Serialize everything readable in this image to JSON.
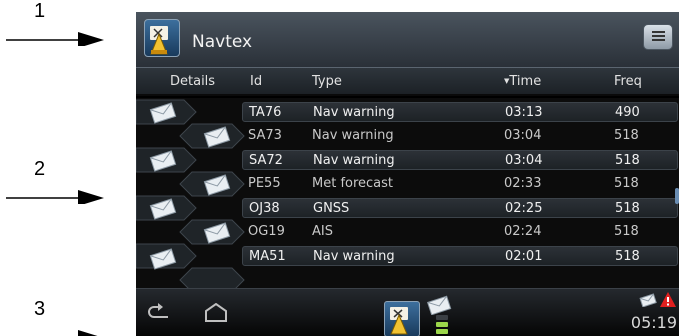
{
  "callouts": [
    {
      "label": "1"
    },
    {
      "label": "2"
    },
    {
      "label": "3"
    }
  ],
  "app": {
    "title": "Navtex",
    "icon": "navtex-buoy-icon",
    "menu_icon": "menu-icon"
  },
  "table": {
    "columns": [
      "Details",
      "Id",
      "Type",
      "Time",
      "Freq"
    ],
    "sort_indicator": "▼",
    "sort_column": "Time",
    "rows": [
      {
        "id": "TA76",
        "type": "Nav warning",
        "time": "03:13",
        "freq": "490"
      },
      {
        "id": "SA73",
        "type": "Nav warning",
        "time": "03:04",
        "freq": "518"
      },
      {
        "id": "SA72",
        "type": "Nav warning",
        "time": "03:04",
        "freq": "518"
      },
      {
        "id": "PE55",
        "type": "Met forecast",
        "time": "02:33",
        "freq": "518"
      },
      {
        "id": "OJ38",
        "type": "GNSS",
        "time": "02:25",
        "freq": "518"
      },
      {
        "id": "OG19",
        "type": "AIS",
        "time": "02:24",
        "freq": "518"
      },
      {
        "id": "MA51",
        "type": "Nav warning",
        "time": "02:01",
        "freq": "518"
      }
    ]
  },
  "statusbar": {
    "clock": "05:19",
    "icons": [
      "back-icon",
      "home-icon",
      "navtex-launcher-icon",
      "message-icon",
      "alert-icon"
    ]
  },
  "colors": {
    "accent": "#6a8db3",
    "signal": "#9bd64a",
    "alert": "#e01f1f"
  }
}
